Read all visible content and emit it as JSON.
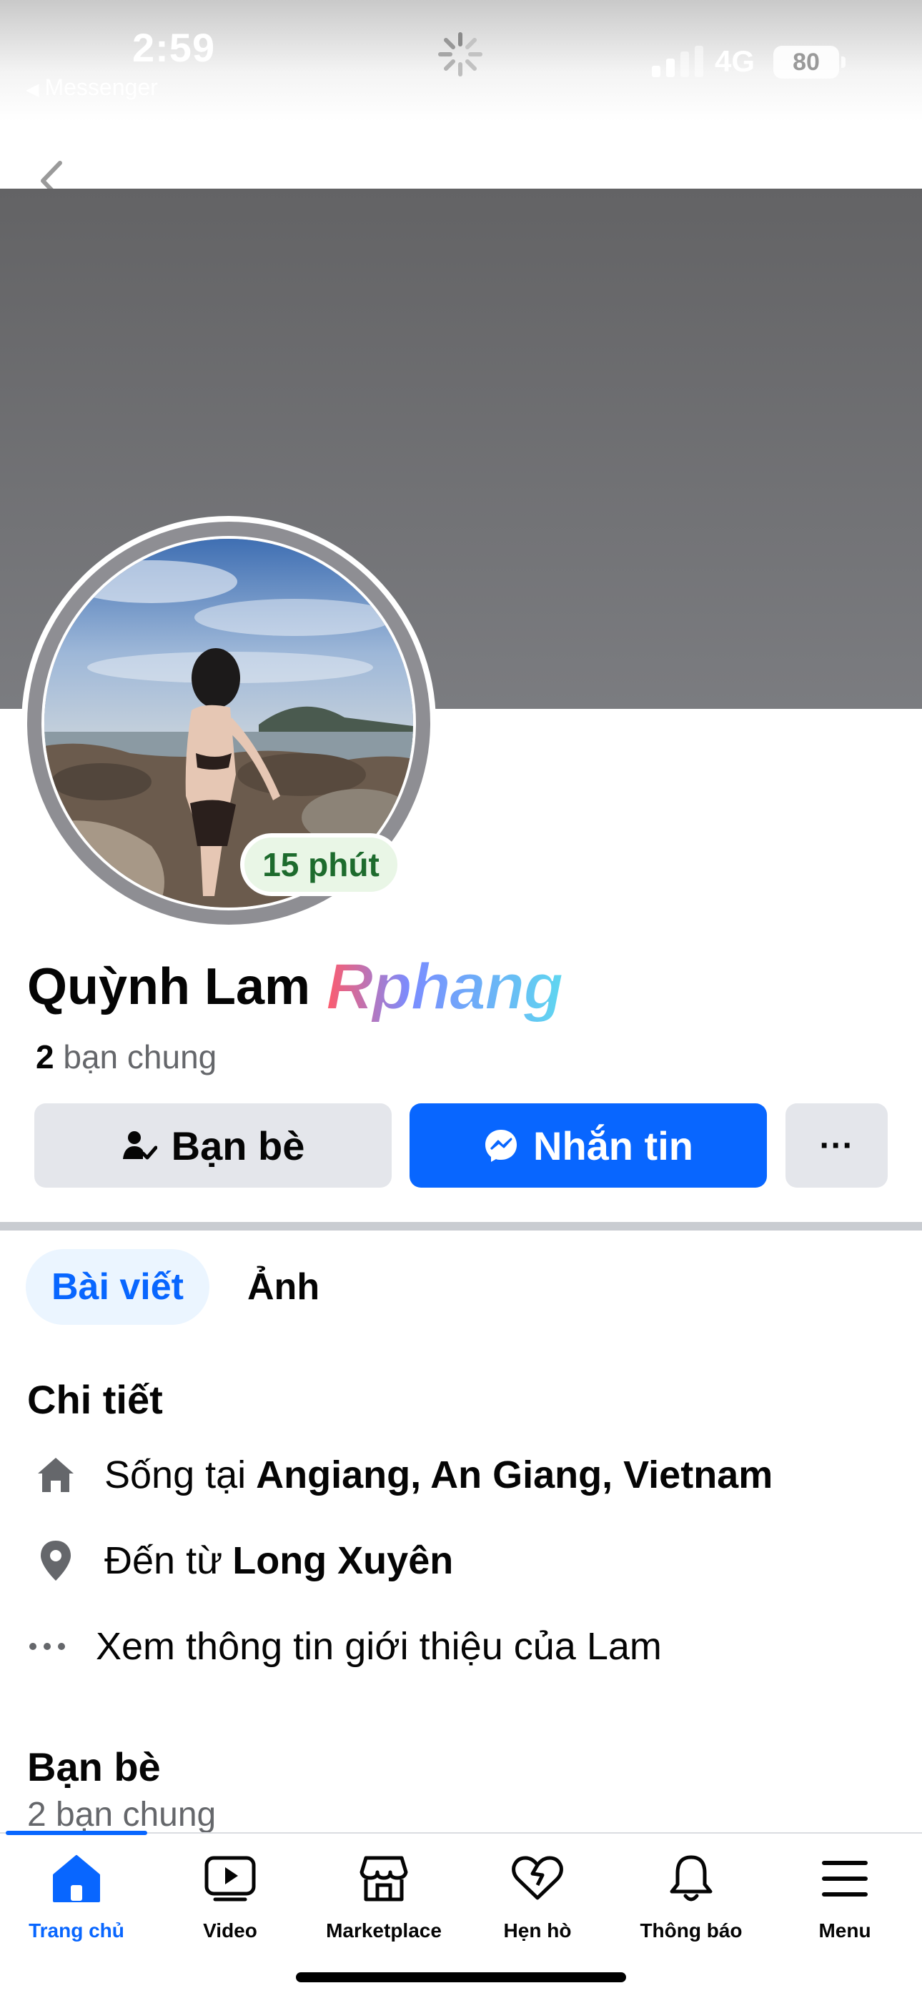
{
  "status_bar": {
    "time": "2:59",
    "back_app": "Messenger",
    "network": "4G",
    "battery": "80"
  },
  "profile": {
    "name": "Quỳnh Lam",
    "watermark": "Rphang",
    "story_badge": "15 phút",
    "mutual_count": "2",
    "mutual_label": "bạn chung"
  },
  "actions": {
    "friends_label": "Bạn bè",
    "message_label": "Nhắn tin",
    "more_label": "···"
  },
  "tabs": [
    {
      "label": "Bài viết",
      "active": true
    },
    {
      "label": "Ảnh",
      "active": false
    }
  ],
  "details": {
    "title": "Chi tiết",
    "lives_prefix": "Sống tại",
    "lives_value": "Angiang, An Giang, Vietnam",
    "from_prefix": "Đến từ",
    "from_value": "Long Xuyên",
    "see_about": "Xem thông tin giới thiệu của Lam"
  },
  "friends_section": {
    "title": "Bạn bè",
    "subtitle": "2 bạn chung"
  },
  "bottom_nav": [
    {
      "label": "Trang chủ",
      "icon": "home-icon",
      "active": true
    },
    {
      "label": "Video",
      "icon": "video-icon",
      "active": false
    },
    {
      "label": "Marketplace",
      "icon": "marketplace-icon",
      "active": false
    },
    {
      "label": "Hẹn hò",
      "icon": "heart-icon",
      "active": false
    },
    {
      "label": "Thông báo",
      "icon": "bell-icon",
      "active": false
    },
    {
      "label": "Menu",
      "icon": "menu-icon",
      "active": false
    }
  ],
  "colors": {
    "accent": "#0866ff",
    "secondary_button": "#e4e6eb",
    "cover": "#6e6f72",
    "badge_text": "#1d6b2d"
  }
}
